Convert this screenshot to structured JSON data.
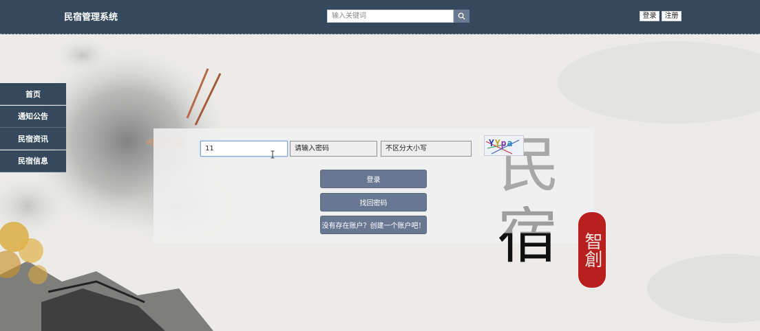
{
  "header": {
    "brand": "民宿管理系统",
    "search_placeholder": "输入关键词",
    "login_label": "登录",
    "register_label": "注册"
  },
  "sidebar": {
    "items": [
      {
        "label": "首页"
      },
      {
        "label": "通知公告"
      },
      {
        "label": "民宿资讯"
      },
      {
        "label": "民宿信息"
      }
    ]
  },
  "login_form": {
    "username_value": "11",
    "password_placeholder": "请输入密码",
    "captcha_placeholder": "不区分大小写",
    "captcha_code": "YYpa",
    "login_button": "登录",
    "forgot_button": "找回密码",
    "create_button": "没有存在账户？创建一个账户吧！"
  },
  "decoration": {
    "char_min": "民",
    "char_su": "宿",
    "seal_text": "智創"
  },
  "colors": {
    "header_bg": "#34495e",
    "button_bg": "#697892",
    "seal_red": "#b8201d"
  }
}
